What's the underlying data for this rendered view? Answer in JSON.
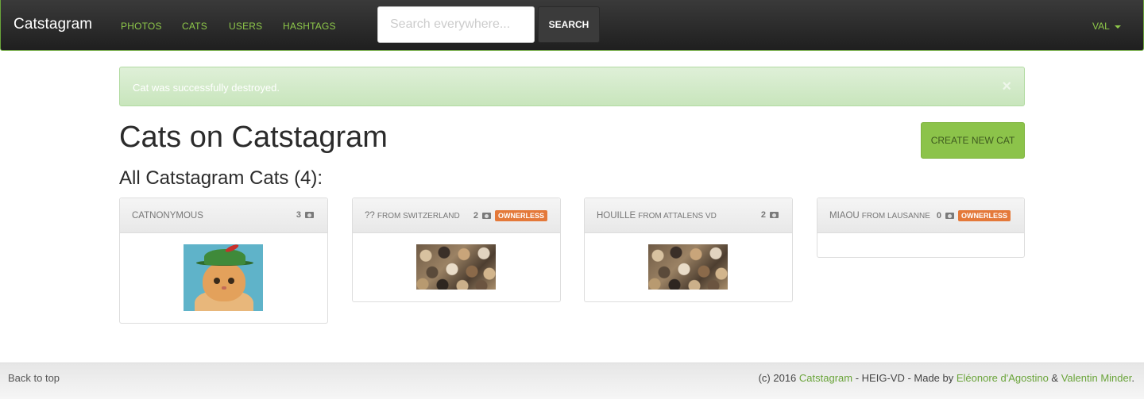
{
  "navbar": {
    "brand": "Catstagram",
    "links": [
      "PHOTOS",
      "CATS",
      "USERS",
      "HASHTAGS"
    ],
    "search_placeholder": "Search everywhere...",
    "search_label": "SEARCH",
    "user_label": "VAL"
  },
  "alert": {
    "message": "Cat was successfully destroyed.",
    "close": "×"
  },
  "main": {
    "title": "Cats on Catstagram",
    "create_label": "CREATE NEW CAT",
    "subtitle": "All Catstagram Cats (4):"
  },
  "cats": [
    {
      "name": "CATNONYMOUS",
      "from": "",
      "photos": "3",
      "badge": ""
    },
    {
      "name": "??",
      "from": "FROM SWITZERLAND",
      "photos": "2",
      "badge": "OWNERLESS"
    },
    {
      "name": "HOUILLE",
      "from": "FROM ATTALENS VD",
      "photos": "2",
      "badge": ""
    },
    {
      "name": "MIAOU",
      "from": "FROM LAUSANNE",
      "photos": "0",
      "badge": "OWNERLESS"
    }
  ],
  "icons": {
    "photos": "camera-icon",
    "close": "close-icon",
    "caret": "caret-down-icon"
  },
  "colors": {
    "accent": "#8cc34a",
    "badge": "#e4793a",
    "navbar": "#2b2b2b"
  },
  "footer": {
    "back_to_top": "Back to top",
    "prefix": "(c) 2016 ",
    "site": "Catstagram",
    "middle": " - HEIG-VD - Made by ",
    "author1": "Eléonore d'Agostino",
    "and": " & ",
    "author2": "Valentin Minder",
    "suffix": "."
  }
}
